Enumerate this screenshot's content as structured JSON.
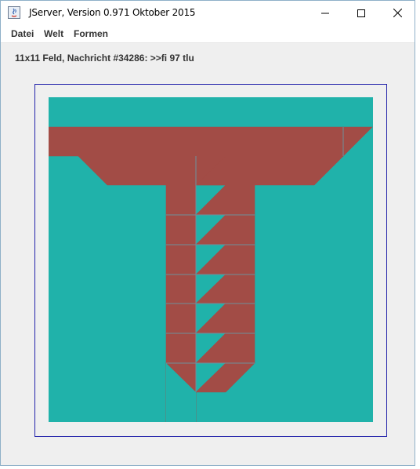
{
  "window": {
    "title": "JServer, Version 0.971 Oktober 2015"
  },
  "menu": {
    "items": [
      "Datei",
      "Welt",
      "Formen"
    ]
  },
  "status_text": "11x11 Feld, Nachricht #34286: >>fi 97 tlu",
  "board": {
    "grid": "11x11",
    "background_color": "#20b2aa",
    "shape_color": "#a24c46",
    "grid_line_color": "#6f8f9a"
  }
}
